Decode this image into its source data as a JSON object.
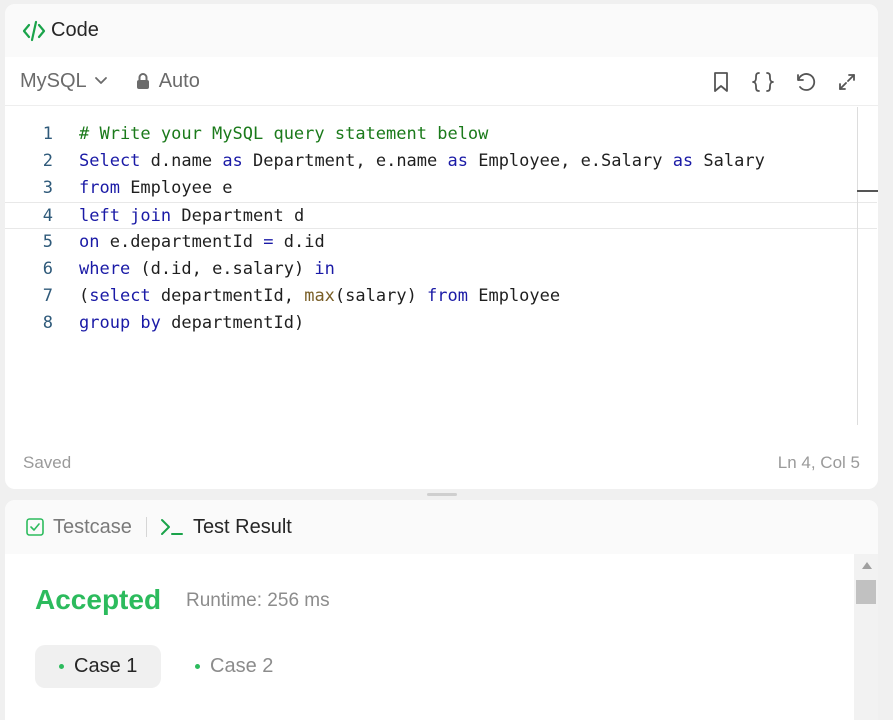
{
  "code_panel": {
    "title": "Code",
    "language": "MySQL",
    "mode": "Auto",
    "status_left": "Saved",
    "status_right": "Ln 4, Col 5",
    "lines": [
      {
        "n": "1",
        "tokens": [
          {
            "t": "# Write your MySQL query statement below",
            "c": "cm"
          }
        ]
      },
      {
        "n": "2",
        "tokens": [
          {
            "t": "Select",
            "c": "kw"
          },
          {
            "t": " d.name ",
            "c": ""
          },
          {
            "t": "as",
            "c": "kw"
          },
          {
            "t": " Department, e.name ",
            "c": ""
          },
          {
            "t": "as",
            "c": "kw"
          },
          {
            "t": " Employee, e.Salary ",
            "c": ""
          },
          {
            "t": "as",
            "c": "kw"
          },
          {
            "t": " Salary",
            "c": ""
          }
        ]
      },
      {
        "n": "3",
        "tokens": [
          {
            "t": "from",
            "c": "kw"
          },
          {
            "t": " Employee e",
            "c": ""
          }
        ]
      },
      {
        "n": "4",
        "tokens": [
          {
            "t": "left join",
            "c": "kw"
          },
          {
            "t": " Department d",
            "c": ""
          }
        ]
      },
      {
        "n": "5",
        "tokens": [
          {
            "t": "on",
            "c": "kw"
          },
          {
            "t": " e.departmentId ",
            "c": ""
          },
          {
            "t": "=",
            "c": "kw"
          },
          {
            "t": " d.id",
            "c": ""
          }
        ]
      },
      {
        "n": "6",
        "tokens": [
          {
            "t": "where",
            "c": "kw"
          },
          {
            "t": " (d.id, e.salary) ",
            "c": ""
          },
          {
            "t": "in",
            "c": "kw"
          }
        ]
      },
      {
        "n": "7",
        "tokens": [
          {
            "t": "(",
            "c": ""
          },
          {
            "t": "select",
            "c": "kw"
          },
          {
            "t": " departmentId, ",
            "c": ""
          },
          {
            "t": "max",
            "c": "fn"
          },
          {
            "t": "(salary) ",
            "c": ""
          },
          {
            "t": "from",
            "c": "kw"
          },
          {
            "t": " Employee",
            "c": ""
          }
        ]
      },
      {
        "n": "8",
        "tokens": [
          {
            "t": "group by",
            "c": "kw"
          },
          {
            "t": " departmentId)",
            "c": ""
          }
        ]
      }
    ],
    "active_line": 4
  },
  "test_panel": {
    "tab_testcase": "Testcase",
    "tab_result": "Test Result",
    "verdict": "Accepted",
    "runtime": "Runtime: 256 ms",
    "cases": [
      "Case 1",
      "Case 2"
    ]
  },
  "colors": {
    "accent_green": "#2cbb5d",
    "keyword": "#1a1aa6",
    "comment": "#1b7a1b"
  },
  "icons": [
    "code-icon",
    "chevron-down-icon",
    "lock-icon",
    "bookmark-icon",
    "braces-format-icon",
    "undo-icon",
    "expand-icon",
    "checkbox-icon",
    "terminal-icon"
  ]
}
